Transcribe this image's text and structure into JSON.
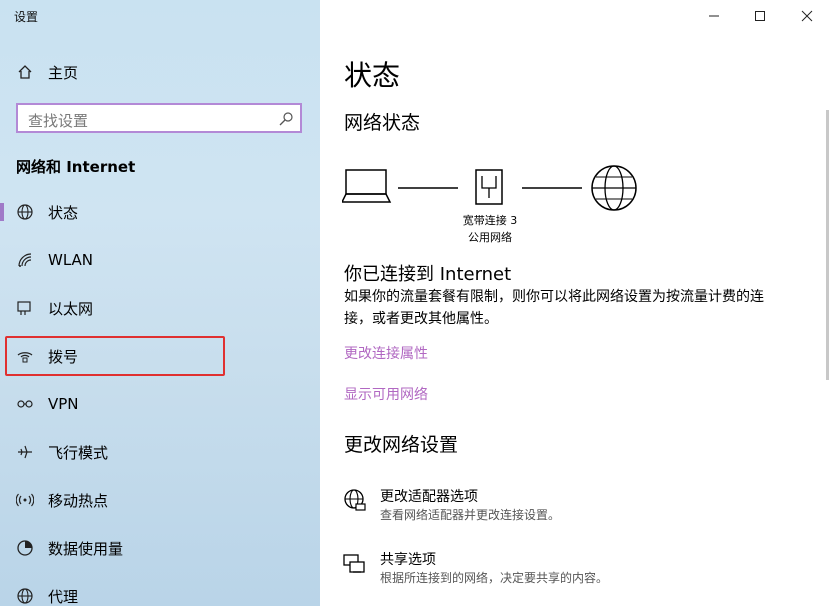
{
  "window": {
    "title": "设置",
    "minimize": "─",
    "maximize": "□",
    "close": "✕"
  },
  "sidebar": {
    "home": "主页",
    "search_placeholder": "查找设置",
    "section": "网络和 Internet",
    "items": [
      {
        "label": "状态",
        "icon": "globe-icon"
      },
      {
        "label": "WLAN",
        "icon": "wifi-icon"
      },
      {
        "label": "以太网",
        "icon": "ethernet-icon"
      },
      {
        "label": "拨号",
        "icon": "dialup-icon"
      },
      {
        "label": "VPN",
        "icon": "vpn-icon"
      },
      {
        "label": "飞行模式",
        "icon": "airplane-icon"
      },
      {
        "label": "移动热点",
        "icon": "hotspot-icon"
      },
      {
        "label": "数据使用量",
        "icon": "data-usage-icon"
      },
      {
        "label": "代理",
        "icon": "proxy-globe-icon"
      }
    ],
    "accent": "#a07ac8",
    "highlight_color": "#e03030"
  },
  "main": {
    "title": "状态",
    "network_status": "网络状态",
    "connection": {
      "name": "宽带连接 3",
      "type": "公用网络"
    },
    "connected_title": "你已连接到 Internet",
    "connected_desc": "如果你的流量套餐有限制，则你可以将此网络设置为按流量计费的连接，或者更改其他属性。",
    "link_properties": "更改连接属性",
    "link_available": "显示可用网络",
    "change_settings": "更改网络设置",
    "options": [
      {
        "title": "更改适配器选项",
        "desc": "查看网络适配器并更改连接设置。",
        "icon": "adapter-icon"
      },
      {
        "title": "共享选项",
        "desc": "根据所连接到的网络，决定要共享的内容。",
        "icon": "sharing-icon"
      }
    ],
    "link_color": "#b168c2"
  }
}
